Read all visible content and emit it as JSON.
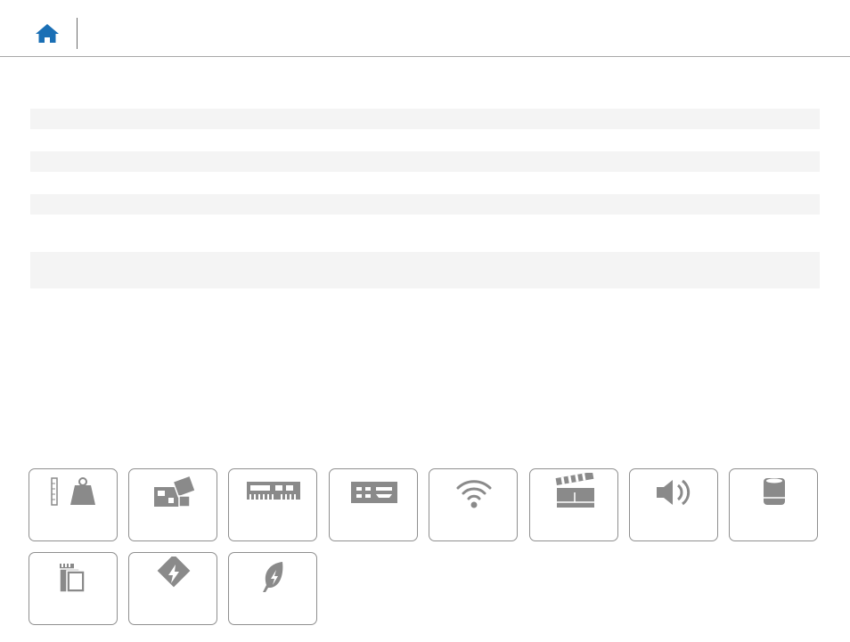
{
  "header": {
    "home_icon": "home-icon"
  },
  "content_rows": [
    {
      "label": ""
    },
    {
      "label": ""
    },
    {
      "label": ""
    },
    {
      "label": ""
    }
  ],
  "tiles": [
    {
      "icon": "dimensions-weight-icon",
      "label": ""
    },
    {
      "icon": "system-board-icon",
      "label": ""
    },
    {
      "icon": "memory-icon",
      "label": ""
    },
    {
      "icon": "ports-icon",
      "label": ""
    },
    {
      "icon": "wireless-icon",
      "label": ""
    },
    {
      "icon": "video-icon",
      "label": ""
    },
    {
      "icon": "audio-icon",
      "label": ""
    },
    {
      "icon": "storage-icon",
      "label": ""
    },
    {
      "icon": "media-card-icon",
      "label": ""
    },
    {
      "icon": "power-adapter-icon",
      "label": ""
    },
    {
      "icon": "environment-icon",
      "label": ""
    }
  ],
  "colors": {
    "home_blue": "#1a6fb5",
    "icon_gray": "#8a8a8a",
    "row_bg": "#f4f4f4"
  }
}
